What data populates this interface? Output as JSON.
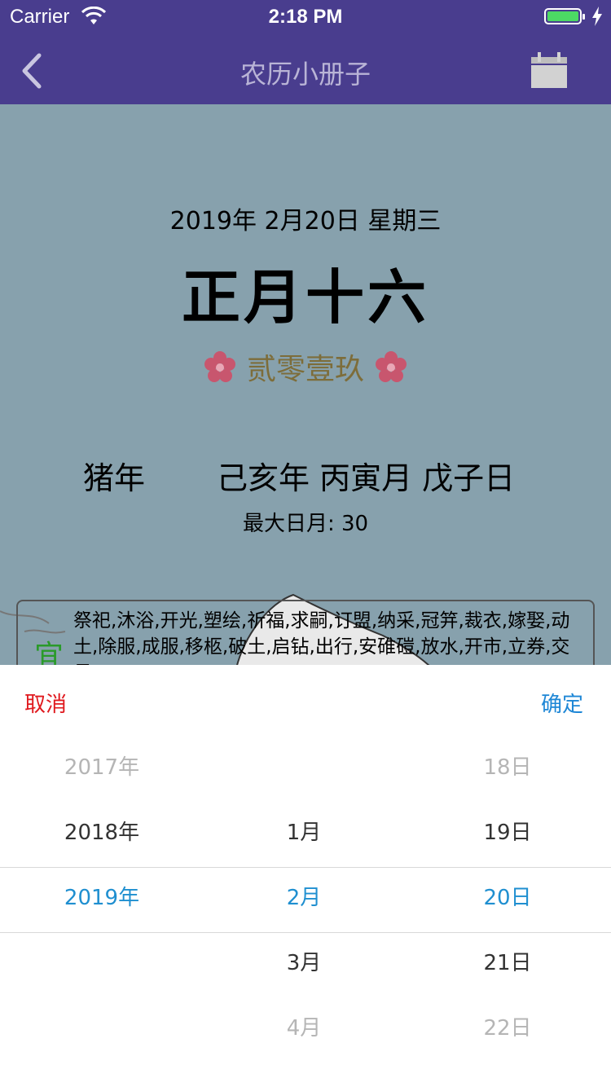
{
  "status_bar": {
    "carrier": "Carrier",
    "time": "2:18 PM"
  },
  "nav": {
    "title": "农历小册子",
    "back_icon": "chevron-left-icon",
    "calendar_icon": "calendar-icon"
  },
  "day_info": {
    "solar_date": "2019年 2月20日 星期三",
    "lunar_date": "正月十六",
    "year_in_words": "贰零壹玖",
    "zodiac_year": "猪年",
    "ganzhi": "己亥年 丙寅月 戊子日",
    "max_day": "最大日月: 30"
  },
  "yi": {
    "label": "宜",
    "items": "祭祀,沐浴,开光,塑绘,祈福,求嗣,订盟,纳采,冠笄,裁衣,嫁娶,动土,除服,成服,移柩,破土,启钻,出行,安碓磑,放水,开市,立券,交易"
  },
  "picker": {
    "cancel_label": "取消",
    "confirm_label": "确定",
    "years": [
      "2017年",
      "2018年",
      "2019年",
      "",
      ""
    ],
    "months": [
      "",
      "1月",
      "2月",
      "3月",
      "4月"
    ],
    "days": [
      "18日",
      "19日",
      "20日",
      "21日",
      "22日"
    ],
    "selected": {
      "year": "2019年",
      "month": "2月",
      "day": "20日"
    }
  },
  "colors": {
    "nav_bg": "#493d8e",
    "page_bg": "#87a1ad",
    "selected_text": "#1f8fd0",
    "cancel": "#e0191e",
    "confirm": "#1e87d6",
    "yi_mark": "#2a9a2a",
    "flower": "#c8566e"
  }
}
